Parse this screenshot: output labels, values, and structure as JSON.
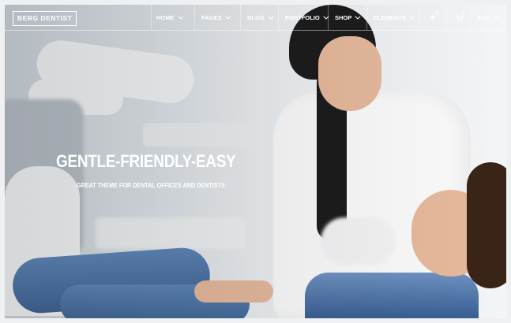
{
  "header": {
    "logo": "BERG DENTIST",
    "menu": [
      {
        "label": "HOME"
      },
      {
        "label": "PAGES"
      },
      {
        "label": "BLOG"
      },
      {
        "label": "PORTFOLIO"
      },
      {
        "label": "SHOP"
      },
      {
        "label": "ELEMENTS"
      }
    ],
    "wishlist_count": "0",
    "cart_count": "0",
    "language": "ENG",
    "icons": [
      "star-icon",
      "cart-icon",
      "search-icon"
    ]
  },
  "hero": {
    "title": "GENTLE-FRIENDLY-EASY",
    "subtitle": "GREAT THEME FOR DENTAL OFFICES AND DENTISTS"
  }
}
